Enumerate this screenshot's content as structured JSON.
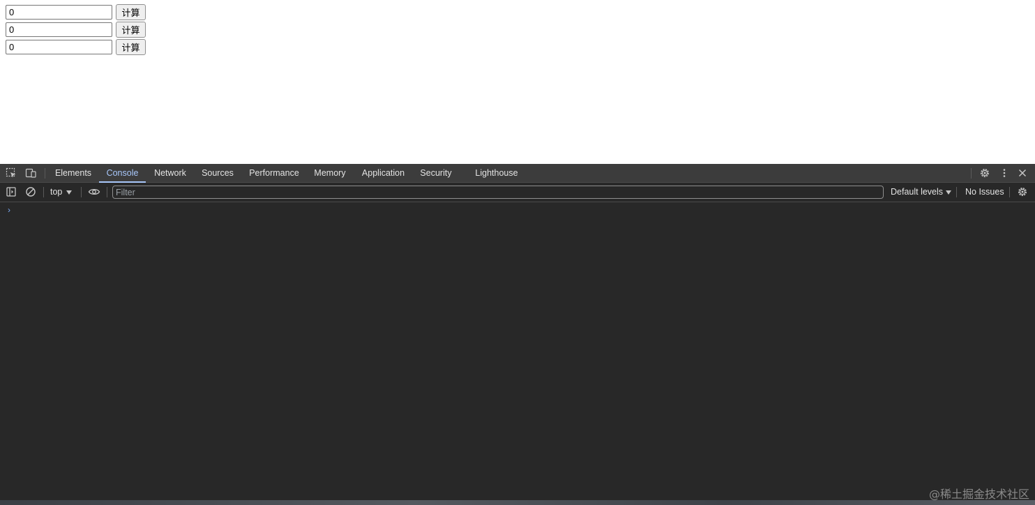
{
  "calculators": [
    {
      "value": "0",
      "button_label": "计算"
    },
    {
      "value": "0",
      "button_label": "计算"
    },
    {
      "value": "0",
      "button_label": "计算"
    }
  ],
  "devtools": {
    "tabs": [
      {
        "label": "Elements"
      },
      {
        "label": "Console",
        "active": true
      },
      {
        "label": "Network"
      },
      {
        "label": "Sources"
      },
      {
        "label": "Performance"
      },
      {
        "label": "Memory"
      },
      {
        "label": "Application"
      },
      {
        "label": "Security"
      },
      {
        "label": "Lighthouse"
      }
    ],
    "tabbar_icons": [
      "inspect-element-icon",
      "device-toolbar-icon",
      "settings-gear-icon",
      "more-options-icon",
      "close-icon"
    ],
    "toolbar": {
      "context": "top",
      "filter_placeholder": "Filter",
      "levels": "Default levels",
      "issues": "No Issues"
    },
    "toolbar_icons": [
      "sidebar-toggle-icon",
      "clear-console-icon",
      "live-expression-eye-icon",
      "console-settings-gear-icon"
    ],
    "prompt_symbol": "›",
    "colors": {
      "panel_bg": "#282828",
      "tabbar_bg": "#3c3c3c",
      "accent": "#a8c7fa",
      "text": "#e3e3e3"
    }
  },
  "watermark": "@稀土掘金技术社区"
}
